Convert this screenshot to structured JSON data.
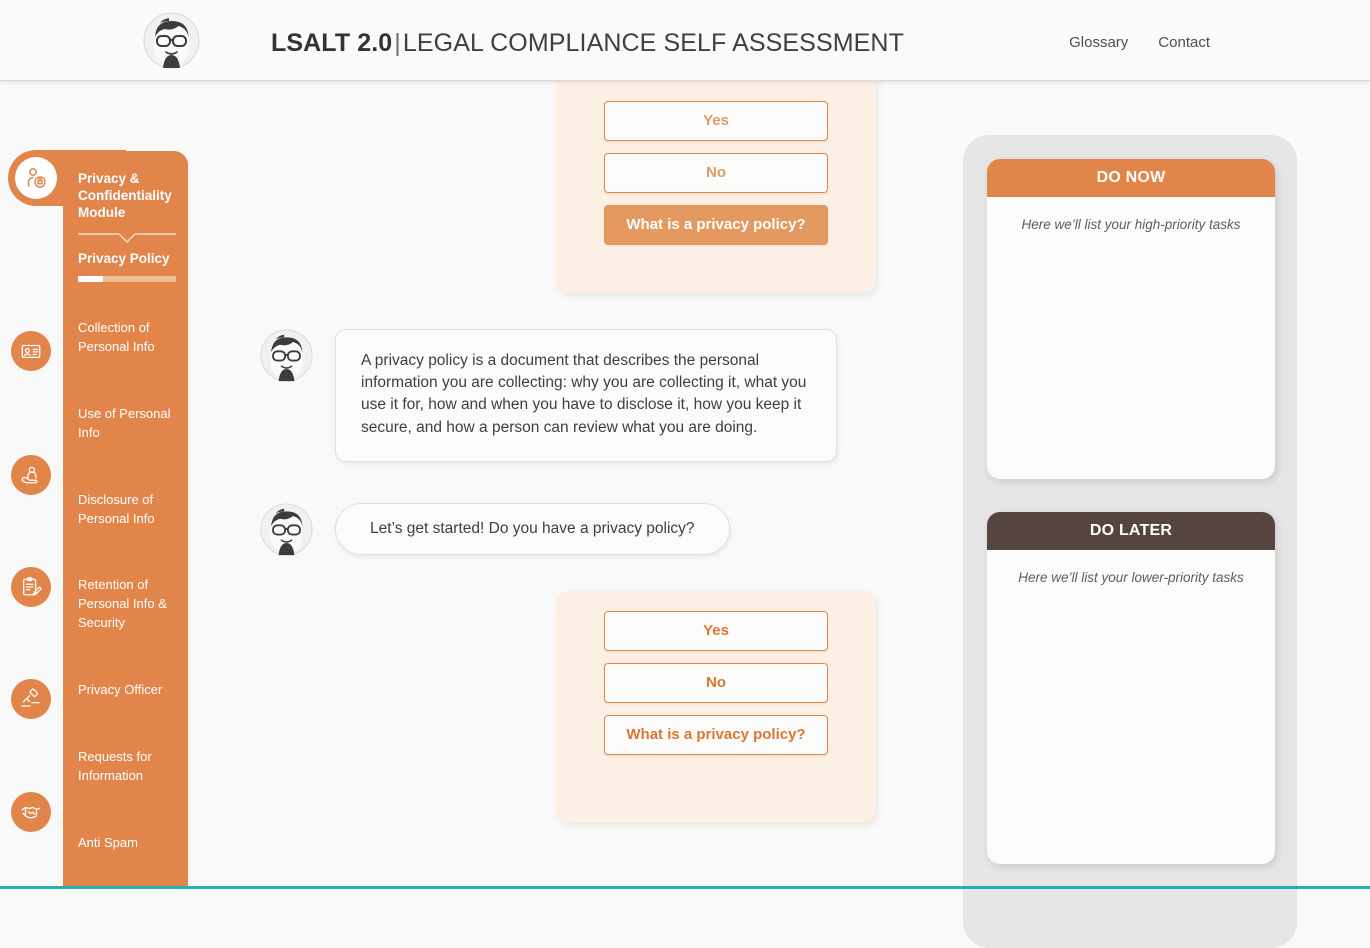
{
  "header": {
    "logo_icon": "avatar-character-icon",
    "brand_strong": "LSALT 2.0",
    "brand_separator": "|",
    "brand_rest": "LEGAL COMPLIANCE SELF ASSESSMENT",
    "nav": [
      {
        "label": "Glossary",
        "name": "nav-link-glossary"
      },
      {
        "label": "Contact",
        "name": "nav-link-contact"
      }
    ]
  },
  "sidebar": {
    "module_title": "Privacy & Confidentiality Module",
    "current_section": "Privacy Policy",
    "progress_percent": 25,
    "items": [
      {
        "label": "Collection of Personal Info",
        "icon": "id-card-icon"
      },
      {
        "label": "Use of Personal Info",
        "icon": "hand-person-icon"
      },
      {
        "label": "Disclosure of Personal Info",
        "icon": ""
      },
      {
        "label": "Retention of Personal Info & Security",
        "icon": "clipboard-pen-icon"
      },
      {
        "label": "Privacy Officer",
        "icon": "gavel-icon"
      },
      {
        "label": "Requests for Information",
        "icon": ""
      },
      {
        "label": "Anti Spam",
        "icon": "handshake-icon"
      }
    ],
    "active_icon": "person-lock-icon"
  },
  "chat": {
    "answer_card_top": {
      "buttons": [
        {
          "label": "Yes",
          "style": "outline"
        },
        {
          "label": "No",
          "style": "outline"
        },
        {
          "label": "What is a privacy policy?",
          "style": "solid"
        }
      ]
    },
    "messages": [
      {
        "avatar": "avatar-character-icon",
        "type": "paragraph",
        "text": "A privacy policy is a document that describes the personal information you are collecting: why you are collecting it, what you use it for, how and when you have to disclose it, how you keep it secure, and how a person can review what you are doing."
      },
      {
        "avatar": "avatar-character-icon",
        "type": "pill",
        "text": "Let’s get started! Do you have a privacy policy?"
      }
    ],
    "answer_card_bottom": {
      "buttons": [
        {
          "label": "Yes",
          "style": "outline-strong"
        },
        {
          "label": "No",
          "style": "outline-strong"
        },
        {
          "label": "What is a privacy policy?",
          "style": "outline-strong"
        }
      ]
    },
    "scrollbar": {
      "up_arrow": "chevron-up-icon",
      "down_arrow": "chevron-down-icon"
    }
  },
  "tasks": {
    "cards": [
      {
        "title": "DO NOW",
        "placeholder": "Here we’ll list your high-priority tasks",
        "header_color": "#e2854b"
      },
      {
        "title": "DO LATER",
        "placeholder": "Here we’ll list your lower-priority tasks",
        "header_color": "#554440"
      }
    ]
  },
  "colors": {
    "accent_orange": "#e2854b",
    "accent_orange_light": "#e3995f",
    "answer_card_bg": "#fcefe4",
    "do_later_brown": "#554440",
    "footer_teal": "#23b0b0",
    "panel_grey": "#e6e6e6"
  }
}
